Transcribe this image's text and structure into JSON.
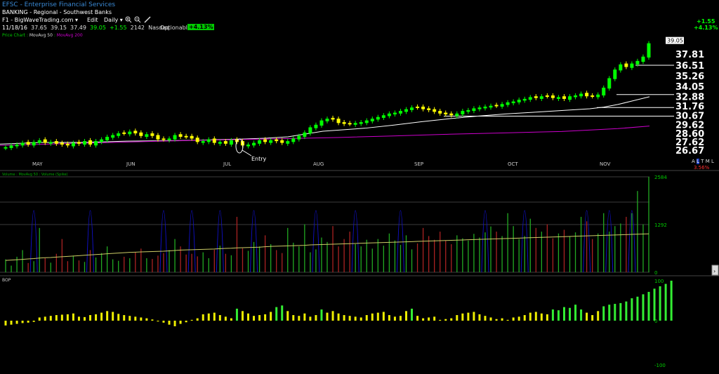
{
  "header": {
    "title": "EFSC - Enterprise Financial Services",
    "sector": "BANKING - Regional - Southwest Banks",
    "source": "F1 - BigWaveTrading.com",
    "dropdown_arrow": "▾",
    "edit_label": "Edit",
    "interval": "Daily",
    "date": "11/18/16",
    "open": "37.65",
    "high": "39.15",
    "low": "37.49",
    "close": "39.05",
    "change": "+1.55",
    "shares": "2142",
    "exchange": "Nasdaq",
    "optionable": "Optionable",
    "change_pct_badge": "+4.13%",
    "right_change": "+1.55",
    "right_change_pct": "+4.13%",
    "study_line": "Price Chart : MovAvg 50 : MovAvg 200",
    "study_price": "Price Chart : ",
    "study_ma50": "MovAvg 50",
    "study_sep": " : ",
    "study_ma200": "MovAvg 200",
    "scale_letters": [
      "A",
      "L",
      "T",
      "M",
      "L"
    ],
    "right_pct": "3.56%",
    "colors": {
      "up": "#00ff00",
      "down": "#ffff00",
      "ma50": "#ffffff",
      "ma200": "#cc00cc",
      "vol_ma": "#cccc66",
      "spike": "#1010cc"
    }
  },
  "chart_data": [
    {
      "type": "line",
      "name": "price",
      "title": "",
      "ylim": [
        26.0,
        40.0
      ],
      "yticks": [
        "37.81",
        "36.51",
        "35.26",
        "34.05",
        "32.88",
        "31.76",
        "30.67",
        "29.62",
        "28.60",
        "27.62",
        "26.67"
      ],
      "price_tag": "39.05",
      "months": [
        "MAY",
        "JUN",
        "JUL",
        "AUG",
        "SEP",
        "OCT",
        "NOV"
      ],
      "annotation": "Entry",
      "series": [
        {
          "name": "MovAvg 50",
          "values": [
            [
              0,
              27.35
            ],
            [
              60,
              27.55
            ],
            [
              120,
              27.55
            ],
            [
              180,
              27.7
            ],
            [
              240,
              27.75
            ],
            [
              280,
              27.8
            ],
            [
              300,
              27.85
            ],
            [
              350,
              27.95
            ],
            [
              380,
              28.05
            ],
            [
              410,
              28.2
            ],
            [
              460,
              28.85
            ],
            [
              520,
              29.2
            ],
            [
              560,
              29.55
            ],
            [
              600,
              29.95
            ],
            [
              640,
              30.3
            ],
            [
              680,
              30.6
            ],
            [
              720,
              30.85
            ],
            [
              760,
              31.05
            ],
            [
              800,
              31.25
            ],
            [
              840,
              31.45
            ],
            [
              860,
              31.65
            ],
            [
              880,
              31.95
            ],
            [
              900,
              32.35
            ],
            [
              925,
              32.85
            ]
          ]
        },
        {
          "name": "MovAvg 200",
          "values": [
            [
              0,
              27.2
            ],
            [
              80,
              27.38
            ],
            [
              160,
              27.55
            ],
            [
              240,
              27.72
            ],
            [
              320,
              27.85
            ],
            [
              400,
              27.98
            ],
            [
              480,
              28.12
            ],
            [
              560,
              28.3
            ],
            [
              640,
              28.5
            ],
            [
              720,
              28.66
            ],
            [
              800,
              28.82
            ],
            [
              880,
              29.15
            ],
            [
              925,
              29.45
            ]
          ]
        }
      ],
      "levels": [
        {
          "value": 36.5,
          "from": 905
        },
        {
          "value": 33.1,
          "from": 878
        },
        {
          "value": 31.6,
          "from": 850
        },
        {
          "value": 30.6,
          "from": 632
        }
      ],
      "candles_note": "approximate daily closes",
      "closes": [
        27.0,
        27.2,
        27.3,
        27.5,
        27.3,
        27.6,
        27.8,
        27.5,
        27.6,
        27.4,
        27.3,
        27.2,
        27.5,
        27.4,
        27.7,
        27.3,
        27.7,
        27.9,
        28.2,
        28.4,
        28.6,
        28.6,
        28.8,
        28.6,
        28.3,
        28.5,
        28.3,
        27.9,
        27.9,
        28.0,
        28.4,
        28.2,
        28.2,
        28.0,
        27.6,
        27.7,
        27.9,
        27.5,
        27.6,
        27.4,
        27.8,
        27.6,
        27.2,
        27.3,
        27.5,
        27.8,
        27.6,
        27.8,
        27.7,
        27.5,
        27.7,
        28.0,
        28.3,
        28.7,
        29.3,
        29.6,
        30.1,
        30.3,
        30.2,
        29.8,
        29.7,
        29.7,
        29.8,
        29.9,
        30.1,
        30.3,
        30.5,
        30.7,
        30.9,
        31.0,
        31.2,
        31.4,
        31.6,
        31.6,
        31.4,
        31.3,
        31.1,
        30.9,
        30.8,
        30.7,
        30.9,
        31.2,
        31.3,
        31.5,
        31.6,
        31.7,
        31.8,
        31.8,
        32.0,
        32.2,
        32.3,
        32.5,
        32.6,
        32.8,
        32.7,
        32.9,
        32.9,
        32.7,
        32.8,
        32.6,
        32.9,
        33.0,
        33.2,
        32.9,
        32.9,
        33.1,
        33.9,
        35.0,
        36.0,
        36.6,
        36.3,
        36.7,
        37.0,
        37.5,
        39.05
      ],
      "updown": [
        1,
        1,
        1,
        1,
        0,
        1,
        1,
        0,
        1,
        0,
        0,
        0,
        1,
        0,
        1,
        0,
        1,
        1,
        1,
        1,
        1,
        0,
        1,
        0,
        0,
        1,
        0,
        0,
        0,
        1,
        1,
        0,
        0,
        0,
        0,
        1,
        1,
        0,
        1,
        0,
        1,
        0,
        0,
        1,
        1,
        1,
        0,
        1,
        0,
        0,
        1,
        1,
        1,
        1,
        1,
        1,
        1,
        1,
        0,
        0,
        0,
        0,
        1,
        1,
        1,
        1,
        1,
        1,
        1,
        1,
        1,
        1,
        1,
        0,
        0,
        0,
        0,
        0,
        0,
        0,
        1,
        1,
        1,
        1,
        1,
        1,
        1,
        0,
        1,
        1,
        1,
        1,
        1,
        1,
        0,
        1,
        0,
        0,
        1,
        0,
        1,
        1,
        1,
        0,
        0,
        1,
        1,
        1,
        1,
        1,
        0,
        1,
        1,
        1,
        1
      ]
    },
    {
      "type": "bar",
      "name": "volume",
      "title": "Volume : MovAvg 50 : Volume (Spike)",
      "ylim": [
        0,
        2584
      ],
      "yticks": [
        "2584",
        "1292",
        "0"
      ],
      "volumes": [
        350,
        180,
        420,
        600,
        250,
        300,
        1200,
        380,
        260,
        500,
        900,
        300,
        450,
        320,
        280,
        600,
        400,
        520,
        700,
        350,
        310,
        420,
        380,
        550,
        640,
        380,
        360,
        450,
        520,
        600,
        900,
        700,
        480,
        500,
        430,
        540,
        380,
        610,
        720,
        500,
        460,
        1500,
        650,
        580,
        820,
        700,
        1000,
        760,
        600,
        520,
        1200,
        800,
        700,
        1300,
        540,
        620,
        940,
        820,
        1250,
        700,
        900,
        1100,
        760,
        700,
        880,
        640,
        900,
        720,
        1050,
        860,
        740,
        1000,
        620,
        780,
        1200,
        980,
        880,
        1100,
        860,
        760,
        1000,
        920,
        860,
        1040,
        940,
        1080,
        1240,
        1100,
        980,
        1600,
        1250,
        900,
        980,
        1450,
        1200,
        1100,
        1300,
        920,
        1050,
        1150,
        980,
        1080,
        1500,
        1380,
        900,
        1050,
        1600,
        1100,
        1250,
        1320,
        1500,
        1600,
        2200,
        1300,
        2584
      ],
      "volume_ma": [
        320,
        330,
        340,
        350,
        360,
        370,
        385,
        395,
        400,
        410,
        420,
        430,
        440,
        450,
        460,
        470,
        480,
        490,
        500,
        510,
        520,
        530,
        540,
        545,
        550,
        555,
        560,
        565,
        570,
        580,
        590,
        600,
        605,
        610,
        615,
        620,
        625,
        630,
        640,
        645,
        650,
        660,
        665,
        670,
        675,
        680,
        690,
        700,
        705,
        710,
        715,
        720,
        725,
        730,
        740,
        745,
        750,
        755,
        760,
        765,
        770,
        775,
        780,
        785,
        790,
        795,
        800,
        805,
        810,
        815,
        820,
        825,
        830,
        835,
        840,
        845,
        850,
        855,
        860,
        865,
        870,
        875,
        880,
        885,
        890,
        895,
        900,
        905,
        910,
        915,
        920,
        925,
        930,
        935,
        940,
        945,
        950,
        955,
        960,
        965,
        970,
        975,
        980,
        985,
        990,
        995,
        1000,
        1005,
        1010,
        1015,
        1020,
        1025,
        1030,
        1035,
        1040
      ],
      "spikes": [
        5,
        15,
        28,
        33,
        38,
        44,
        55,
        62,
        70,
        85,
        92,
        103,
        107,
        111
      ]
    },
    {
      "type": "bar",
      "name": "BOP",
      "title": "BOP",
      "ylim": [
        -100,
        100
      ],
      "yticks": [
        "100",
        "0",
        "-100"
      ],
      "bop": [
        -12,
        -10,
        -8,
        -6,
        -5,
        -3,
        8,
        10,
        12,
        14,
        15,
        16,
        18,
        10,
        9,
        14,
        16,
        20,
        24,
        22,
        17,
        14,
        12,
        10,
        8,
        6,
        3,
        -2,
        -5,
        -10,
        -14,
        -8,
        -4,
        2,
        6,
        16,
        18,
        20,
        14,
        10,
        6,
        30,
        24,
        18,
        12,
        14,
        16,
        22,
        34,
        38,
        24,
        14,
        12,
        18,
        10,
        14,
        28,
        20,
        24,
        18,
        14,
        12,
        10,
        8,
        14,
        18,
        20,
        22,
        14,
        10,
        12,
        24,
        30,
        12,
        6,
        8,
        10,
        2,
        4,
        6,
        14,
        18,
        20,
        22,
        16,
        12,
        8,
        4,
        6,
        2,
        8,
        10,
        14,
        20,
        22,
        18,
        16,
        28,
        26,
        34,
        32,
        40,
        28,
        20,
        14,
        24,
        36,
        40,
        42,
        44,
        48,
        56,
        60,
        66,
        72,
        80,
        86,
        92,
        100
      ]
    }
  ]
}
